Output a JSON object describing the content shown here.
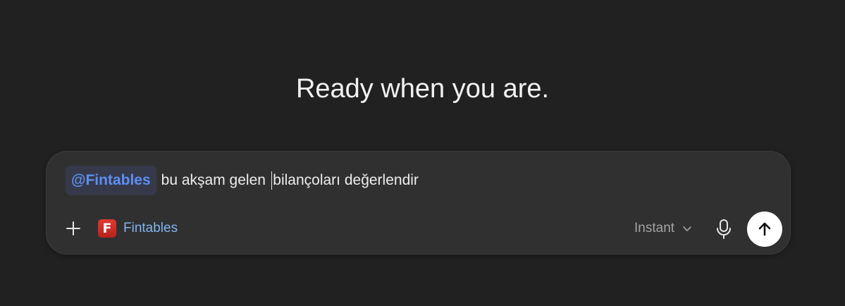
{
  "headline": "Ready when you are.",
  "composer": {
    "mention": "@Fintables",
    "text_before_caret": "bu akşam gelen ",
    "text_after_caret": "bilançoları değerlendir",
    "app": {
      "logo_letter": "F",
      "name": "Fintables",
      "logo_color": "#d12b25"
    },
    "model": {
      "selected": "Instant"
    },
    "icons": {
      "add": "plus-icon",
      "mic": "microphone-icon",
      "send": "arrow-up-icon",
      "dropdown": "chevron-down-icon"
    }
  },
  "colors": {
    "background": "#212121",
    "composer": "#303030",
    "mention": "#5c8ff0",
    "app_name": "#80b4ee",
    "send_button": "#ffffff"
  }
}
